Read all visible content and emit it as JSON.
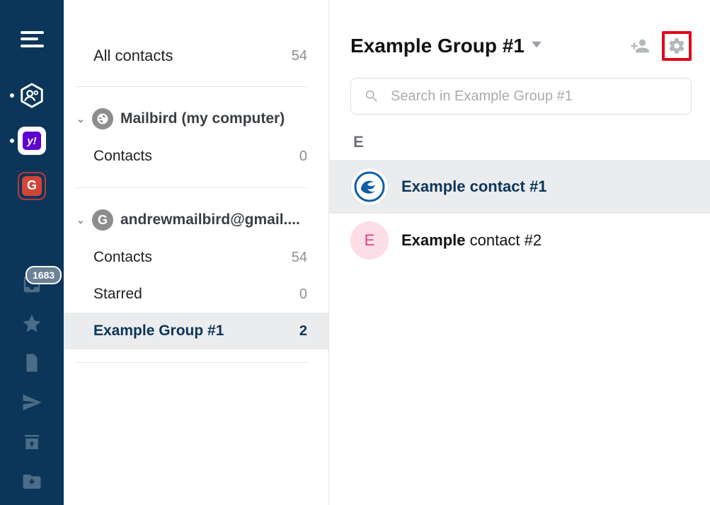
{
  "rail": {
    "accounts": {
      "yahoo_label": "y!",
      "google_label": "G"
    },
    "badge_count": "1683"
  },
  "sidebar": {
    "all_contacts": {
      "label": "All contacts",
      "count": "54"
    },
    "mailbird": {
      "label": "Mailbird (my computer)",
      "items": [
        {
          "label": "Contacts",
          "count": "0"
        }
      ]
    },
    "gmail": {
      "label": "andrewmailbird@gmail....",
      "items": [
        {
          "label": "Contacts",
          "count": "54"
        },
        {
          "label": "Starred",
          "count": "0"
        },
        {
          "label": "Example Group #1",
          "count": "2"
        }
      ]
    }
  },
  "main": {
    "title": "Example Group #1",
    "search_placeholder": "Search in Example Group #1",
    "section_letter": "E",
    "contacts": [
      {
        "name_bold": "Example contact #1",
        "name_rest": "",
        "avatar_letter": ""
      },
      {
        "name_bold": "Example",
        "name_rest": " contact #2",
        "avatar_letter": "E"
      }
    ]
  }
}
